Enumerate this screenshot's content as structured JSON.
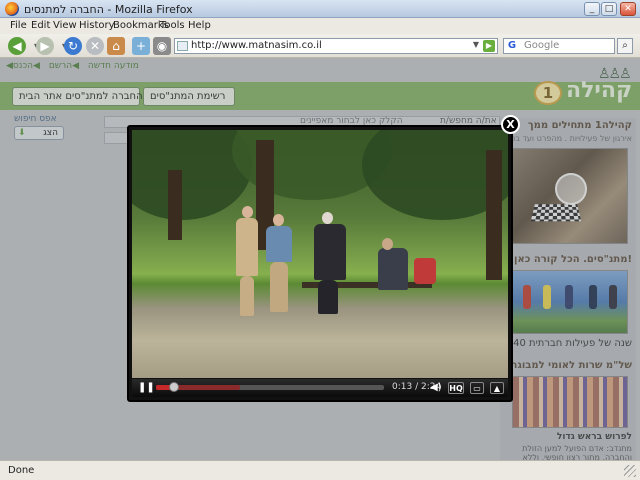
{
  "window": {
    "title": "החברה למתנסים - Mozilla Firefox"
  },
  "menu": [
    "File",
    "Edit",
    "View",
    "History",
    "Bookmarks",
    "Tools",
    "Help"
  ],
  "address": {
    "url": "http://www.matnasim.co.il"
  },
  "search": {
    "placeholder": "Google"
  },
  "page": {
    "top_links": [
      "הכנס",
      "הרשם",
      "מודעה חדשה"
    ],
    "logo_text": "קהילה",
    "logo_number": "1",
    "tabs": [
      "רשימת המתנ\"סים",
      "החברה למתנ\"סים אתר הבית"
    ],
    "left_link": "אפס חיפוש",
    "left_button": "הצג",
    "search_hint": "הקלק כאן לבחור מאפיינים",
    "search_label": "מה את/ה מחפש/ת",
    "sidebar": {
      "head1": "קהילה1 מתחילים ממך",
      "sub1": "אירגון של פעילויות . מהפרט ועד בכל",
      "head2": "מתנ\"סים. הכל קורה כאן!",
      "sub2": "40 שנה של פעילות חברתית",
      "head3": "של\"מ שרות לאומי למבוגר",
      "foot1": "לפרוש בראש גדול",
      "foot2": "מתנדב: אדם הפועל למען הזולת והחברה, מתוך רצון חופשי, וללא קבלת"
    }
  },
  "player": {
    "time": "0:13 / 2:24",
    "progress": 0.08,
    "buffered": 0.37,
    "hq_label": "HQ"
  },
  "status": {
    "text": "Done"
  }
}
